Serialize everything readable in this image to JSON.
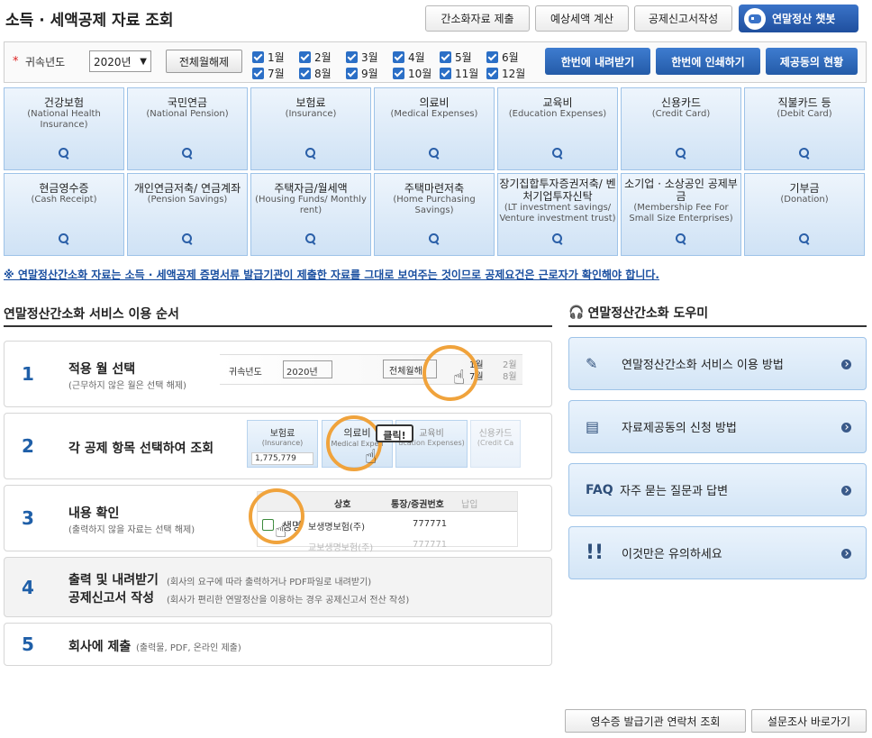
{
  "page": {
    "title": "소득 · 세액공제 자료 조회"
  },
  "top_buttons": [
    "간소화자료 제출",
    "예상세액 계산",
    "공제신고서작성"
  ],
  "chatbot": {
    "label": "연말정산 챗봇"
  },
  "filter": {
    "year_label": "귀속년도",
    "year_value": "2020년",
    "deselect_label": "전체월해제",
    "months": [
      "1월",
      "2월",
      "3월",
      "4월",
      "5월",
      "6월",
      "7월",
      "8월",
      "9월",
      "10월",
      "11월",
      "12월"
    ],
    "actions": [
      "한번에 내려받기",
      "한번에 인쇄하기",
      "제공동의 현황"
    ]
  },
  "tiles": [
    {
      "name": "건강보험",
      "en": "(National Health Insurance)"
    },
    {
      "name": "국민연금",
      "en": "(National Pension)"
    },
    {
      "name": "보험료",
      "en": "(Insurance)"
    },
    {
      "name": "의료비",
      "en": "(Medical Expenses)"
    },
    {
      "name": "교육비",
      "en": "(Education Expenses)"
    },
    {
      "name": "신용카드",
      "en": "(Credit Card)"
    },
    {
      "name": "직불카드 등",
      "en": "(Debit Card)"
    },
    {
      "name": "현금영수증",
      "en": "(Cash Receipt)"
    },
    {
      "name": "개인연금저축/ 연금계좌",
      "en": "(Pension Savings)"
    },
    {
      "name": "주택자금/월세액",
      "en": "(Housing Funds/ Monthly rent)"
    },
    {
      "name": "주택마련저축",
      "en": "(Home Purchasing Savings)"
    },
    {
      "name": "장기집합투자증권저축/ 벤처기업투자신탁",
      "en": "(LT investment savings/ Venture investment trust)"
    },
    {
      "name": "소기업 · 소상공인 공제부금",
      "en": "(Membership Fee For Small Size Enterprises)"
    },
    {
      "name": "기부금",
      "en": "(Donation)"
    }
  ],
  "notice": "※ 연말정산간소화 자료는 소득 · 세액공제 증명서류 발급기관이 제출한 자료를 그대로 보여주는 것이므로 공제요건은 근로자가 확인해야 합니다.",
  "steps_title": "연말정산간소화 서비스 이용 순서",
  "steps": [
    {
      "num": "1",
      "label": "적용 월 선택",
      "sub": "(근무하지 않은 월은 선택 해제)"
    },
    {
      "num": "2",
      "label": "각 공제 항목 선택하여 조회",
      "sub": ""
    },
    {
      "num": "3",
      "label": "내용 확인",
      "sub": "(출력하지 않을 자료는 선택 해제)"
    },
    {
      "num": "4",
      "label": "출력 및 내려받기",
      "label2": "공제신고서 작성",
      "sub": "(회사의 요구에 따라 출력하거나 PDF파일로 내려받기)",
      "sub2": "(회사가 편리한 연말정산을 이용하는 경우 공제신고서 전산 작성)"
    },
    {
      "num": "5",
      "label": "회사에 제출",
      "sub": "(출력물, PDF, 온라인 제출)"
    }
  ],
  "step_illus": {
    "s1": {
      "year_label": "귀속년도",
      "year_value": "2020년",
      "deselect": "전체월해",
      "m1": "1월",
      "m7": "7월",
      "m2": "2월",
      "m8": "8월"
    },
    "s2": {
      "t1": "보험료",
      "t1en": "(Insurance)",
      "t1val": "1,775,779",
      "t2": "의료비",
      "t2en": "Medical Expen",
      "click": "클릭!",
      "t3": "교육비",
      "t3en": "ucation Expenses)",
      "t4": "신용카드",
      "t4en": "(Credit Ca"
    },
    "s3": {
      "col1": "상호",
      "col2": "통장/증권번호",
      "col3": "납입",
      "row1name": "생명",
      "row1co": "보생명보험(주)",
      "row1no": "777771",
      "row2co": "교보생명보험(주)",
      "row2no": "777771"
    }
  },
  "help_title": "연말정산간소화 도우미",
  "help": [
    {
      "icon": "FAQ",
      "label": "연말정산간소화 서비스 이용 방법"
    },
    {
      "label": "자료제공동의 신청 방법"
    },
    {
      "icon_text": "FAQ",
      "label": "자주 묻는 질문과 답변"
    },
    {
      "label": "이것만은 유의하세요"
    }
  ],
  "bottom_buttons": [
    "영수증 발급기관 연락처 조회",
    "설문조사 바로가기"
  ]
}
